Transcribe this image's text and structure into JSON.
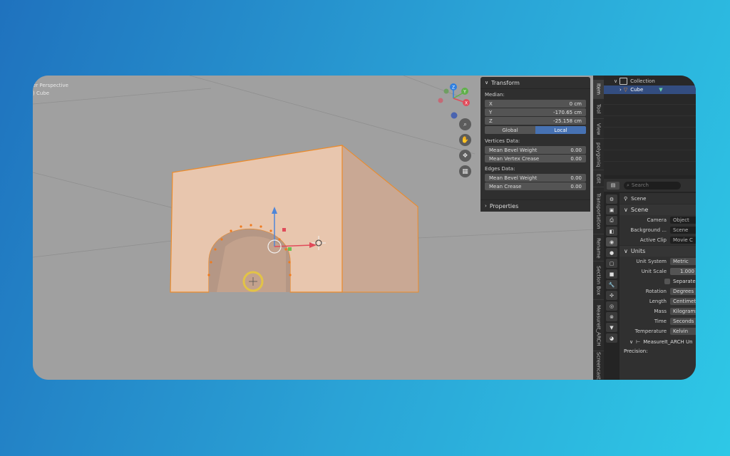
{
  "viewport": {
    "perspective_label": "er Perspective",
    "object_label": ") Cube",
    "gizmo_labels": {
      "z": "Z",
      "y": "Y",
      "x": "X"
    },
    "gizmo_colors": {
      "z": "#2e7fe0",
      "y": "#5fb04a",
      "x": "#e04b5a",
      "neg": "#4a64b0"
    }
  },
  "npanel": {
    "transform_title": "Transform",
    "median_label": "Median:",
    "median": [
      {
        "axis": "X",
        "value": "0 cm"
      },
      {
        "axis": "Y",
        "value": "-170.65 cm"
      },
      {
        "axis": "Z",
        "value": "-25.158 cm"
      }
    ],
    "global_label": "Global",
    "local_label": "Local",
    "vertices_label": "Vertices Data:",
    "vertices": [
      {
        "label": "Mean Bevel Weight",
        "value": "0.00"
      },
      {
        "label": "Mean Vertex Crease",
        "value": "0.00"
      }
    ],
    "edges_label": "Edges Data:",
    "edges": [
      {
        "label": "Mean Bevel Weight",
        "value": "0.00"
      },
      {
        "label": "Mean Crease",
        "value": "0.00"
      }
    ],
    "properties_title": "Properties"
  },
  "side_tabs": [
    "Item",
    "Tool",
    "View",
    "polygoniq",
    "Edit",
    "Transportation",
    "Rename",
    "Section Box",
    "MeasureIt_ARCH",
    "Screencast"
  ],
  "outliner": {
    "collection_label": "Collection",
    "cube_label": "Cube"
  },
  "properties": {
    "search_placeholder": "Search",
    "scene_title": "Scene",
    "scene_section": "Scene",
    "camera_label": "Camera",
    "camera_value": "Object",
    "background_label": "Background ...",
    "background_value": "Scene",
    "active_clip_label": "Active Clip",
    "active_clip_value": "Movie C",
    "units_section": "Units",
    "unit_system_label": "Unit System",
    "unit_system_value": "Metric",
    "unit_scale_label": "Unit Scale",
    "unit_scale_value": "1.000",
    "separate_label": "Separate",
    "rotation_label": "Rotation",
    "rotation_value": "Degrees",
    "length_label": "Length",
    "length_value": "Centimeter",
    "mass_label": "Mass",
    "mass_value": "Kilograms",
    "time_label": "Time",
    "time_value": "Seconds",
    "temperature_label": "Temperature",
    "temperature_value": "Kelvin",
    "measureit_label": "MeasureIt_ARCH Un",
    "precision_label": "Precision:"
  },
  "colors": {
    "accent_blue": "#4772b3",
    "selection_orange": "#f0902a",
    "mesh_face": "#e6bfa4"
  }
}
